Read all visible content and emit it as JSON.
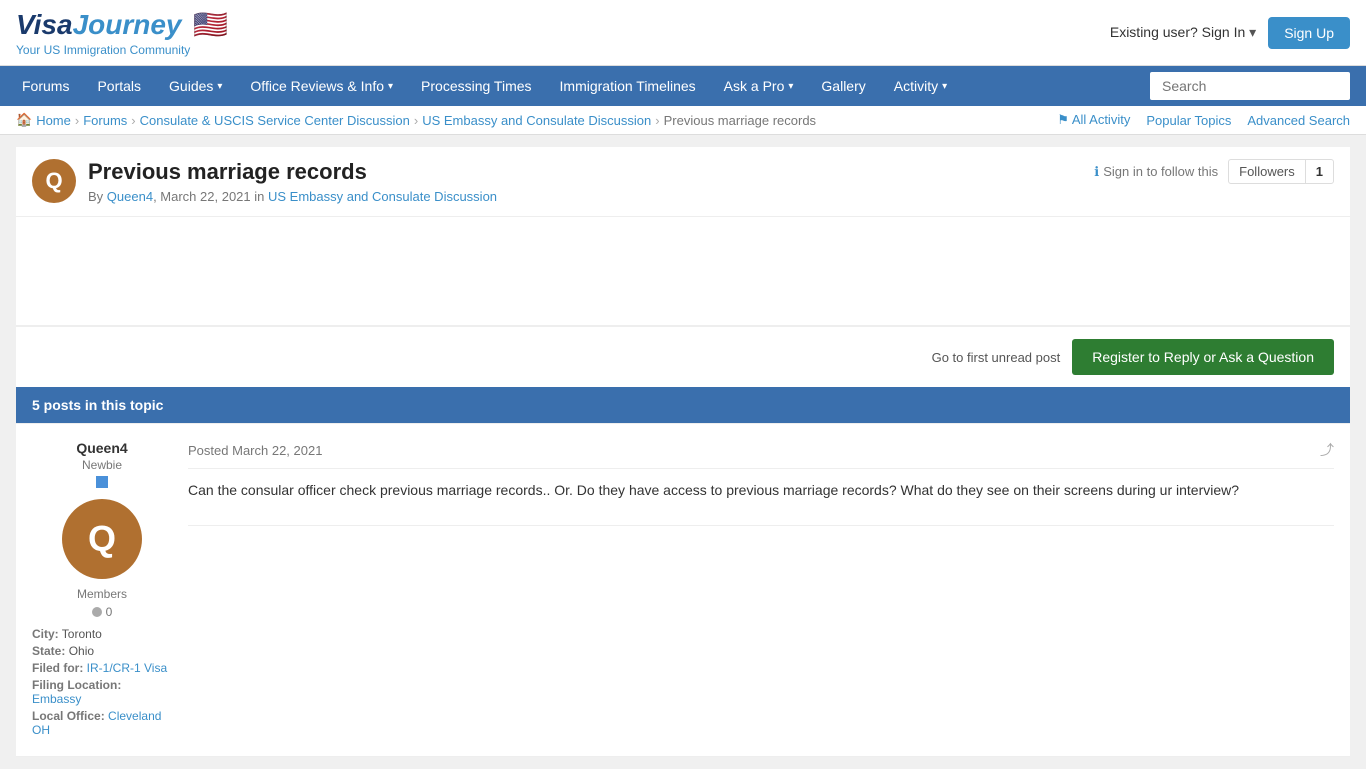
{
  "header": {
    "logo_visa": "Visa",
    "logo_journey": "Journey",
    "logo_tagline": "Your US Immigration Community",
    "existing_user_text": "Existing user? Sign In",
    "signup_label": "Sign Up"
  },
  "nav": {
    "items": [
      {
        "label": "Forums",
        "has_dropdown": false
      },
      {
        "label": "Portals",
        "has_dropdown": false
      },
      {
        "label": "Guides",
        "has_dropdown": true
      },
      {
        "label": "Office Reviews & Info",
        "has_dropdown": true
      },
      {
        "label": "Processing Times",
        "has_dropdown": false
      },
      {
        "label": "Immigration Timelines",
        "has_dropdown": false
      },
      {
        "label": "Ask a Pro",
        "has_dropdown": true
      },
      {
        "label": "Gallery",
        "has_dropdown": false
      },
      {
        "label": "Activity",
        "has_dropdown": true
      }
    ],
    "search_placeholder": "Search"
  },
  "secondary_nav": {
    "breadcrumb": [
      {
        "label": "Home",
        "is_link": true
      },
      {
        "label": "Forums",
        "is_link": true
      },
      {
        "label": "Consulate & USCIS Service Center Discussion",
        "is_link": true
      },
      {
        "label": "US Embassy and Consulate Discussion",
        "is_link": true
      },
      {
        "label": "Previous marriage records",
        "is_link": false
      }
    ],
    "all_activity_label": "All Activity",
    "popular_topics_label": "Popular Topics",
    "advanced_search_label": "Advanced Search"
  },
  "topic": {
    "title": "Previous marriage records",
    "author": "Queen4",
    "date": "March 22, 2021",
    "forum": "US Embassy and Consulate Discussion",
    "avatar_letter": "Q",
    "sign_in_follow": "Sign in to follow this",
    "followers_label": "Followers",
    "followers_count": "1"
  },
  "actions": {
    "go_first_unread": "Go to first unread post",
    "register_reply": "Register to Reply or Ask a Question"
  },
  "posts_bar": {
    "text": "5 posts in this topic"
  },
  "post": {
    "author_name": "Queen4",
    "author_rank": "Newbie",
    "author_avatar_letter": "Q",
    "author_role": "Members",
    "author_rep": "0",
    "author_city_label": "City:",
    "author_city": "Toronto",
    "author_state_label": "State:",
    "author_state": "Ohio",
    "author_filed_label": "Filed for:",
    "author_filed": "IR-1/CR-1 Visa",
    "author_filing_label": "Filing",
    "author_filing_loc_label": "Location:",
    "author_filing": "Embassy",
    "author_local_label": "Local",
    "author_office_label": "Office:",
    "author_local_office": "Cleveland OH",
    "posted_label": "Posted",
    "post_date": "March 22, 2021",
    "post_body": "Can the consular officer check previous marriage records.. Or. Do they have access to previous marriage records? What do they see on their screens during ur interview?"
  }
}
